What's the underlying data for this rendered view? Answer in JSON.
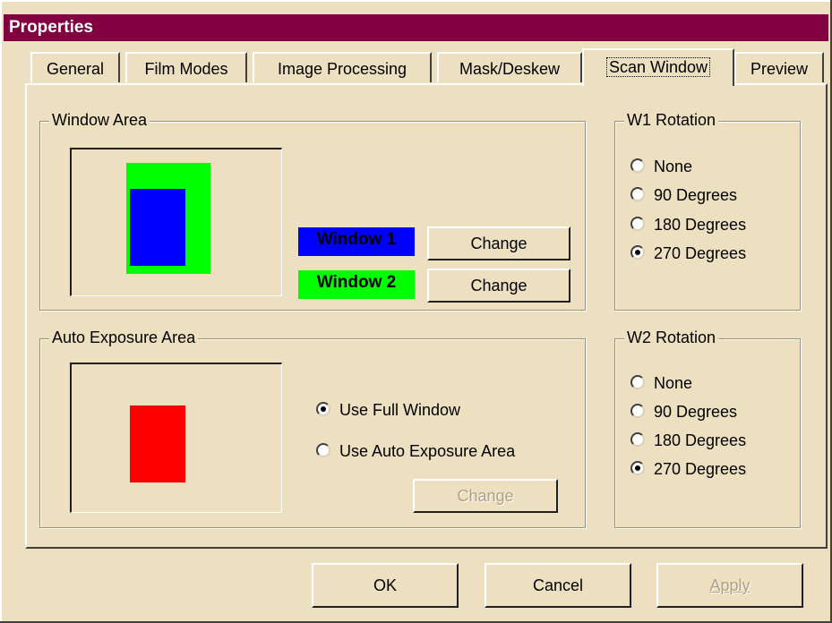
{
  "dialog": {
    "title": "Properties"
  },
  "tabs": [
    "General",
    "Film Modes",
    "Image Processing",
    "Mask/Deskew",
    "Scan Window",
    "Preview"
  ],
  "window_area": {
    "label": "Window Area",
    "window1_label": "Window 1",
    "window2_label": "Window 2",
    "change_label": "Change",
    "window1_color": "#0000ff",
    "window2_color": "#00ff00"
  },
  "auto_exposure": {
    "label": "Auto Exposure Area",
    "options": [
      "Use Full Window",
      "Use Auto Exposure Area"
    ],
    "selected": "Use Full Window",
    "change_label": "Change",
    "area_color": "#ff0000"
  },
  "w1_rotation": {
    "label": "W1 Rotation",
    "options": [
      "None",
      "90 Degrees",
      "180 Degrees",
      "270 Degrees"
    ],
    "selected": "270 Degrees"
  },
  "w2_rotation": {
    "label": "W2 Rotation",
    "options": [
      "None",
      "90 Degrees",
      "180 Degrees",
      "270 Degrees"
    ],
    "selected": "270 Degrees"
  },
  "footer": {
    "ok": "OK",
    "cancel": "Cancel",
    "apply": "Apply"
  }
}
